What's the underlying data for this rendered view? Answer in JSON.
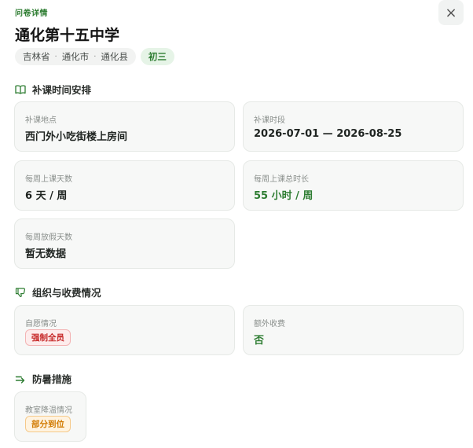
{
  "header": {
    "kicker": "问卷详情",
    "title": "通化第十五中学",
    "location": [
      "吉林省",
      "通化市",
      "通化县"
    ],
    "location_separator": "·",
    "grade": "初三",
    "close_icon": "×"
  },
  "sections": {
    "schedule": {
      "title": "补课时间安排",
      "icon": "book-icon",
      "cards": {
        "place": {
          "label": "补课地点",
          "value": "西门外小吃街楼上房间"
        },
        "period": {
          "label": "补课时段",
          "value": "2026-07-01 — 2026-08-25"
        },
        "days": {
          "label": "每周上课天数",
          "value": "6 天 / 周"
        },
        "hours": {
          "label": "每周上课总时长",
          "value": "55 小时 / 周"
        },
        "rest": {
          "label": "每周放假天数",
          "value": "暂无数据"
        }
      }
    },
    "org": {
      "title": "组织与收费情况",
      "icon": "thumbs-down-icon",
      "cards": {
        "voluntary": {
          "label": "自愿情况",
          "value": "强制全员"
        },
        "fees": {
          "label": "额外收费",
          "value": "否"
        }
      }
    },
    "cooling": {
      "title": "防暑措施",
      "icon": "arrow-right-icon",
      "cards": {
        "classroom": {
          "label": "教室降温情况",
          "value": "部分到位"
        }
      }
    }
  },
  "colors": {
    "accent_green": "#2e7d32",
    "danger_red": "#c62828",
    "warning_orange": "#d17a00"
  }
}
